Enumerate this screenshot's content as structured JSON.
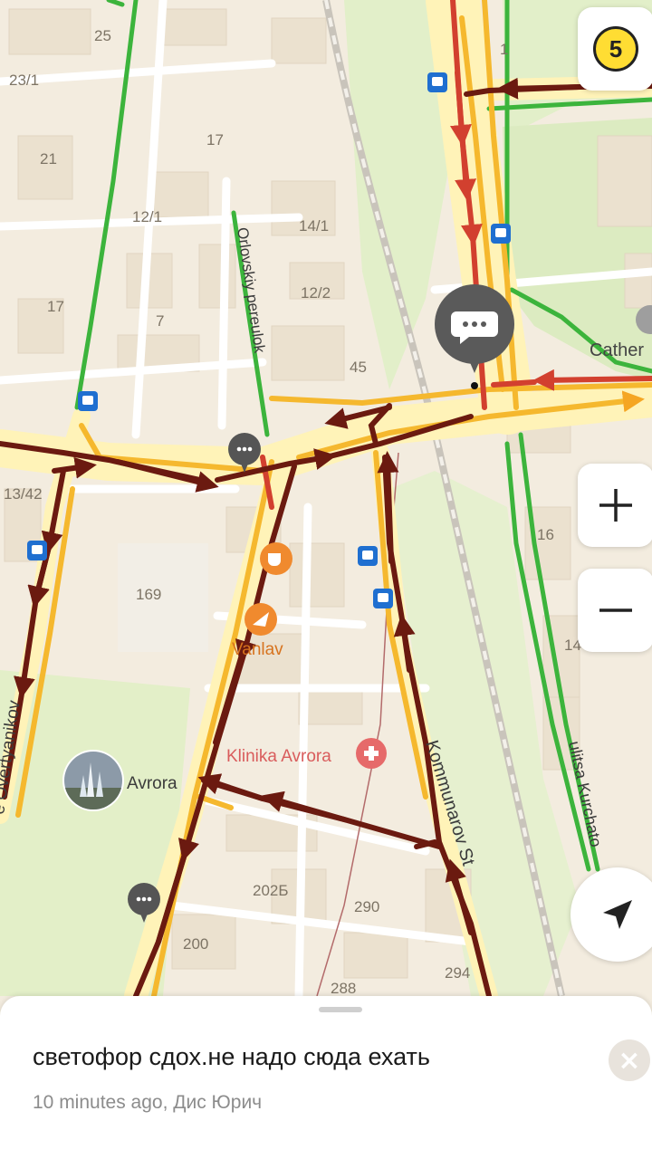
{
  "map": {
    "places": {
      "cathedral": "Cather",
      "vanlav": "Vanlav",
      "klinika": "Klinika Avrora",
      "avrora": "Avrora"
    },
    "streets": {
      "orlovskiy": "Orlovskiy pereulok",
      "kommunarov": "Kommunarov St",
      "kurchatov": "ulitsa Kurchato",
      "overtyanikov": "e Overtyanikov"
    },
    "house_numbers": [
      "25",
      "23/1",
      "21",
      "17",
      "12/1",
      "14/1",
      "12/2",
      "7",
      "17",
      "45",
      "13/42",
      "169",
      "16",
      "14",
      "202Б",
      "290",
      "200",
      "288",
      "294",
      "1"
    ]
  },
  "controls": {
    "traffic_score": "5",
    "zoom_in": "+",
    "zoom_out": "−"
  },
  "sheet": {
    "comment": "светофор сдох.не надо сюда ехать",
    "meta": "10 minutes ago, Дис Юрич",
    "close": "×"
  },
  "colors": {
    "traffic_green": "#3cb43c",
    "traffic_yellow": "#f5b82e",
    "traffic_red": "#d2402f",
    "traffic_darkred": "#6b1a10",
    "poi_orange": "#f08a2e",
    "clinic_red": "#e66a6a",
    "transit_blue": "#1f6fd0"
  }
}
